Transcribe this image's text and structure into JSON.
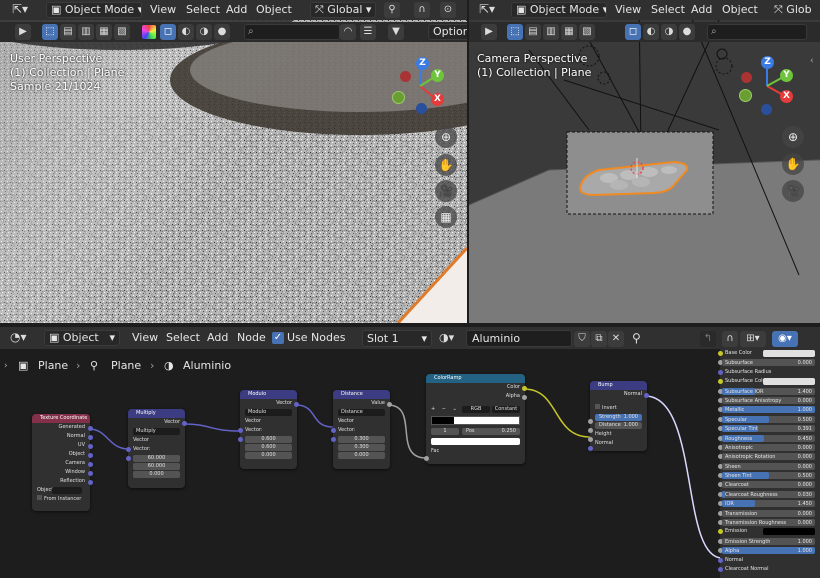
{
  "left_viewport": {
    "mode_dropdown": "Object Mode",
    "menus": [
      "View",
      "Select",
      "Add",
      "Object"
    ],
    "transform_dropdown": "Global",
    "options_label": "Options",
    "overlay_lines": [
      "User Perspective",
      "(1) Collection | Plane",
      "Sample 21/1024"
    ]
  },
  "right_viewport": {
    "mode_dropdown": "Object Mode",
    "menus": [
      "View",
      "Select",
      "Add",
      "Object"
    ],
    "transform_dropdown": "Glob",
    "overlay_lines": [
      "Camera Perspective",
      "(1) Collection | Plane"
    ]
  },
  "axes": {
    "x": "X",
    "y": "Y",
    "z": "Z"
  },
  "node_editor": {
    "header": {
      "object_dropdown": "Object",
      "menus": [
        "View",
        "Select",
        "Add",
        "Node"
      ],
      "use_nodes_label": "Use Nodes",
      "slot_dropdown": "Slot 1",
      "material_name": "Aluminio"
    },
    "breadcrumb": [
      "Plane",
      "Plane",
      "Aluminio"
    ],
    "nodes": {
      "texcoord": {
        "title": "Texture Coordinate",
        "outputs": [
          "Generated",
          "Normal",
          "UV",
          "Object",
          "Camera",
          "Window",
          "Reflection"
        ],
        "object_label": "Object:",
        "from_instancer": "From Instancer"
      },
      "multiply": {
        "title": "Multiply",
        "output": "Vector",
        "operation": "Multiply",
        "inputs": [
          "Vector",
          "Vector:"
        ],
        "values": [
          "60.000",
          "60.000",
          "0.000"
        ]
      },
      "modulo": {
        "title": "Modulo",
        "output": "Vector",
        "operation": "Modulo",
        "inputs": [
          "Vector",
          "Vector:"
        ],
        "values": [
          "0.600",
          "0.600",
          "0.000"
        ]
      },
      "distance": {
        "title": "Distance",
        "output": "Value",
        "operation": "Distance",
        "inputs": [
          "Vector",
          "Vector:"
        ],
        "values": [
          "0.300",
          "0.300",
          "0.000"
        ]
      },
      "colorramp": {
        "title": "ColorRamp",
        "outputs": [
          "Color",
          "Alpha"
        ],
        "mode": "RGB",
        "interpolation": "Constant",
        "index": "1",
        "pos_label": "Pos",
        "pos_value": "0.250",
        "input": "Fac"
      },
      "bump": {
        "title": "Bump",
        "output": "Normal",
        "invert": "Invert",
        "strength_label": "Strength",
        "strength_value": "1.000",
        "distance_label": "Distance",
        "distance_value": "1.000",
        "inputs": [
          "Height",
          "Normal"
        ]
      }
    },
    "bsdf_props": [
      {
        "label": "Base Color",
        "value": "",
        "fill": 0,
        "kind": "color"
      },
      {
        "label": "Subsurface",
        "value": "0.000",
        "fill": 0
      },
      {
        "label": "Subsurface Radius",
        "value": "",
        "fill": 0,
        "kind": "plain"
      },
      {
        "label": "Subsurface Color",
        "value": "",
        "fill": 0,
        "kind": "color"
      },
      {
        "label": "Subsurface IOR",
        "value": "1.400",
        "fill": 0.35
      },
      {
        "label": "Subsurface Anisotropy",
        "value": "0.000",
        "fill": 0
      },
      {
        "label": "Metallic",
        "value": "1.000",
        "fill": 1
      },
      {
        "label": "Specular",
        "value": "0.500",
        "fill": 0.5
      },
      {
        "label": "Specular Tint",
        "value": "0.391",
        "fill": 0.391
      },
      {
        "label": "Roughness",
        "value": "0.450",
        "fill": 0.45
      },
      {
        "label": "Anisotropic",
        "value": "0.000",
        "fill": 0
      },
      {
        "label": "Anisotropic Rotation",
        "value": "0.000",
        "fill": 0
      },
      {
        "label": "Sheen",
        "value": "0.000",
        "fill": 0
      },
      {
        "label": "Sheen Tint",
        "value": "0.500",
        "fill": 0.5
      },
      {
        "label": "Clearcoat",
        "value": "0.000",
        "fill": 0
      },
      {
        "label": "Clearcoat Roughness",
        "value": "0.030",
        "fill": 0.03
      },
      {
        "label": "IOR",
        "value": "1.450",
        "fill": 0.36
      },
      {
        "label": "Transmission",
        "value": "0.000",
        "fill": 0
      },
      {
        "label": "Transmission Roughness",
        "value": "0.000",
        "fill": 0
      },
      {
        "label": "Emission",
        "value": "",
        "fill": 0,
        "kind": "dark"
      },
      {
        "label": "Emission Strength",
        "value": "1.000",
        "fill": 0
      },
      {
        "label": "Alpha",
        "value": "1.000",
        "fill": 1
      },
      {
        "label": "Normal",
        "value": "",
        "fill": 0,
        "kind": "plain"
      },
      {
        "label": "Clearcoat Normal",
        "value": "",
        "fill": 0,
        "kind": "plain"
      }
    ]
  }
}
